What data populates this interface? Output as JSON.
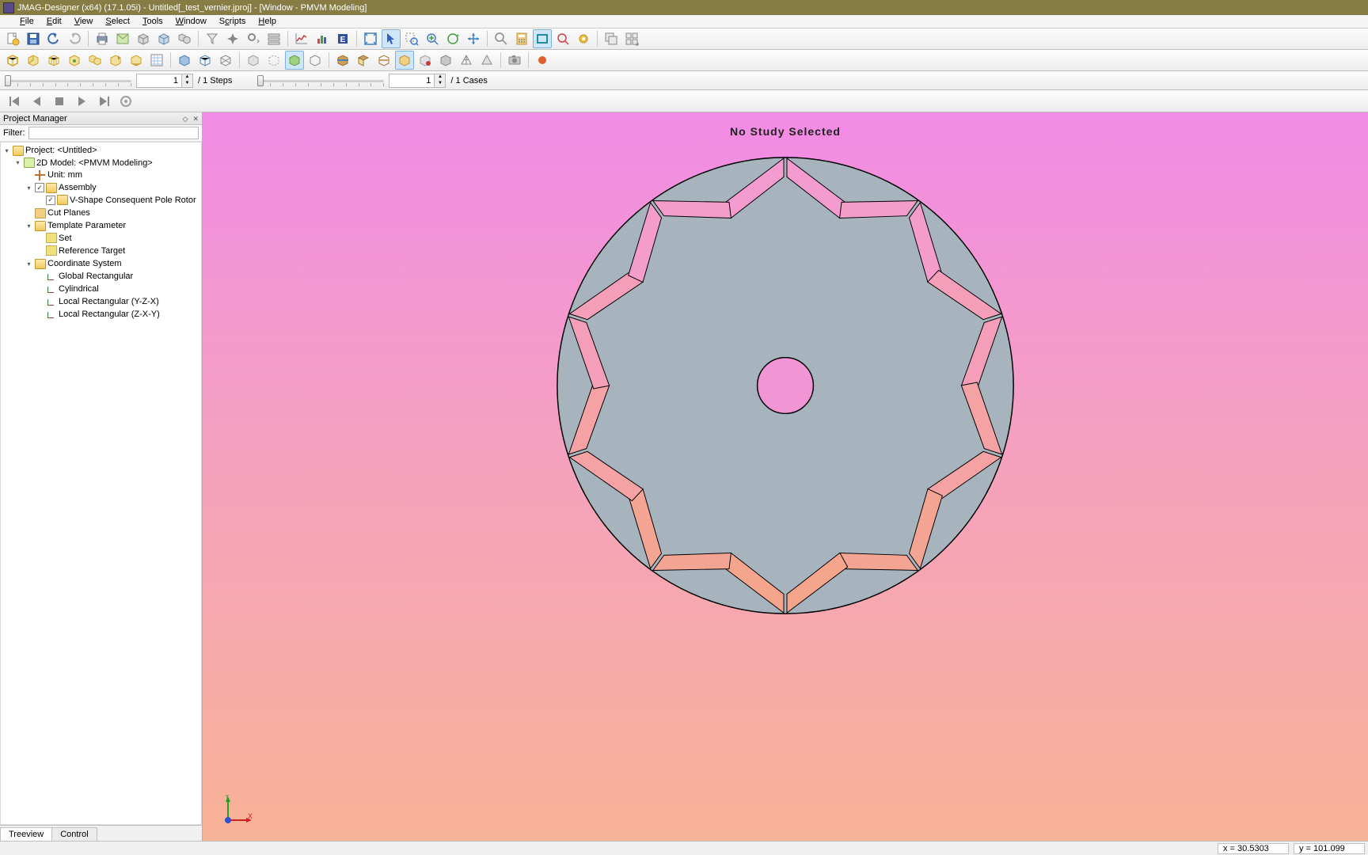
{
  "window": {
    "title": "JMAG-Designer (x64) (17.1.05i) - Untitled[_test_vernier.jproj] - [Window - PMVM Modeling]"
  },
  "menus": [
    "File",
    "Edit",
    "View",
    "Select",
    "Tools",
    "Window",
    "Scripts",
    "Help"
  ],
  "sliders": {
    "step_value": "1",
    "step_label": "/ 1 Steps",
    "case_value": "1",
    "case_label": "/ 1 Cases"
  },
  "panel": {
    "title": "Project Manager",
    "filter_label": "Filter:",
    "filter_value": "",
    "tabs": [
      "Treeview",
      "Control"
    ],
    "tree": {
      "project": "Project: <Untitled>",
      "model": "2D Model: <PMVM Modeling>",
      "unit": "Unit: mm",
      "assembly": "Assembly",
      "rotor": "V-Shape Consequent Pole Rotor",
      "cutplanes": "Cut Planes",
      "template": "Template Parameter",
      "set": "Set",
      "reftarget": "Reference Target",
      "coordsys": "Coordinate System",
      "coord1": "Global Rectangular",
      "coord2": "Cylindrical",
      "coord3": "Local Rectangular (Y-Z-X)",
      "coord4": "Local Rectangular (Z-X-Y)"
    }
  },
  "viewport": {
    "label": "No Study Selected"
  },
  "status": {
    "x": "x =   30.5303",
    "y": "y =   101.099"
  },
  "axis": {
    "x": "X",
    "y": "Y"
  },
  "colors": {
    "rotor_fill": "#a8b4bd",
    "magnet_top": "#f49bd0",
    "magnet_bottom": "#f4a58c"
  }
}
